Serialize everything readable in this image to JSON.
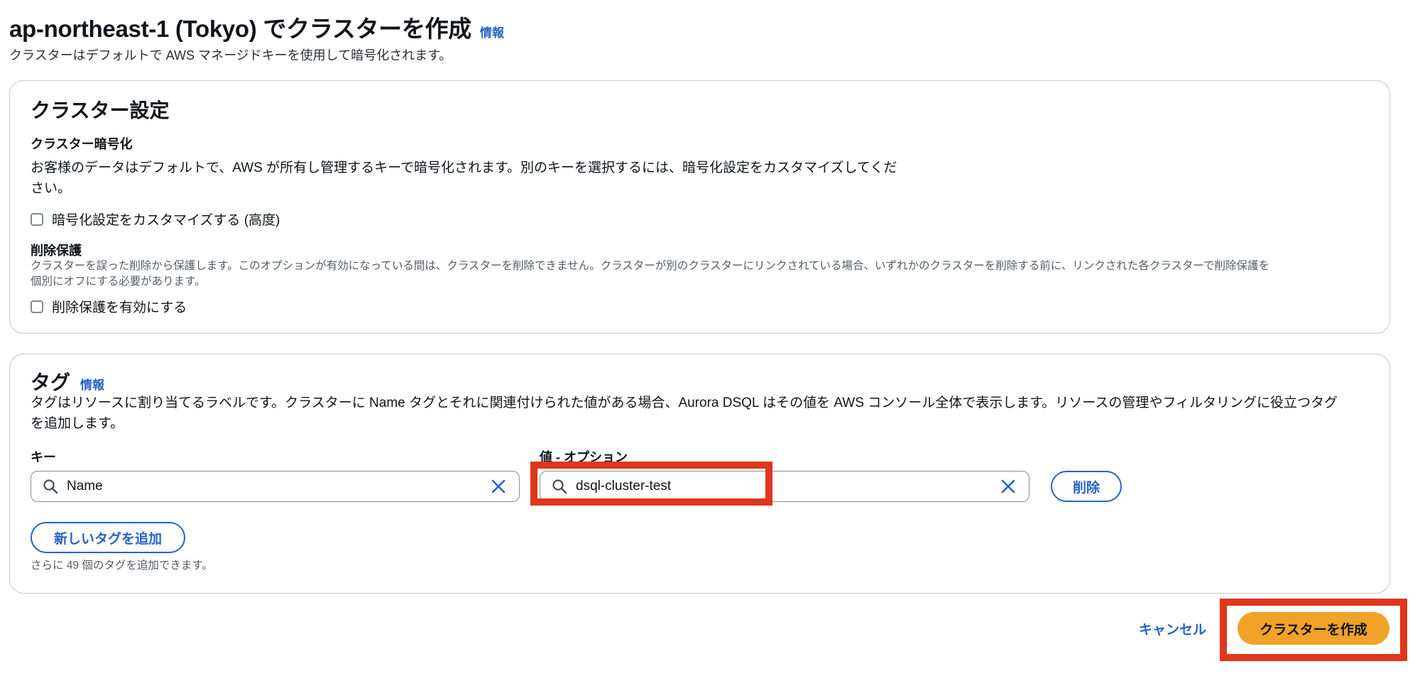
{
  "header": {
    "title": "ap-northeast-1 (Tokyo) でクラスターを作成",
    "info_link": "情報",
    "subtitle": "クラスターはデフォルトで AWS マネージドキーを使用して暗号化されます。"
  },
  "settings": {
    "heading": "クラスター設定",
    "encryption": {
      "label": "クラスター暗号化",
      "description_line1": "お客様のデータはデフォルトで、AWS が所有し管理するキーで暗号化されます。別のキーを選択するには、暗号化設定をカスタマイズしてくだ",
      "description_line2": "さい。",
      "checkbox_label": "暗号化設定をカスタマイズする (高度)",
      "checked": false
    },
    "deletion_protection": {
      "label": "削除保護",
      "description_line1": "クラスターを誤った削除から保護します。このオプションが有効になっている間は、クラスターを削除できません。クラスターが別のクラスターにリンクされている場合、いずれかのクラスターを削除する前に、リンクされた各クラスターで削除保護を",
      "description_line2": "個別にオフにする必要があります。",
      "checkbox_label": "削除保護を有効にする",
      "checked": false
    }
  },
  "tags": {
    "heading": "タグ",
    "info_link": "情報",
    "description_line1": "タグはリソースに割り当てるラベルです。クラスターに Name タグとそれに関連付けられた値がある場合、Aurora DSQL はその値を AWS コンソール全体で表示します。リソースの管理やフィルタリングに役立つタグ",
    "description_line2": "を追加します。",
    "key_label": "キー",
    "value_label": "値 - オプション",
    "key_value": "Name",
    "value_value": "dsql-cluster-test",
    "remove_button": "削除",
    "add_button": "新しいタグを追加",
    "remaining_note": "さらに 49 個のタグを追加できます。"
  },
  "footer": {
    "cancel_label": "キャンセル",
    "create_label": "クラスターを作成"
  },
  "colors": {
    "link": "#2563c9",
    "primary_button": "#f0a328",
    "highlight": "#e0361b"
  }
}
